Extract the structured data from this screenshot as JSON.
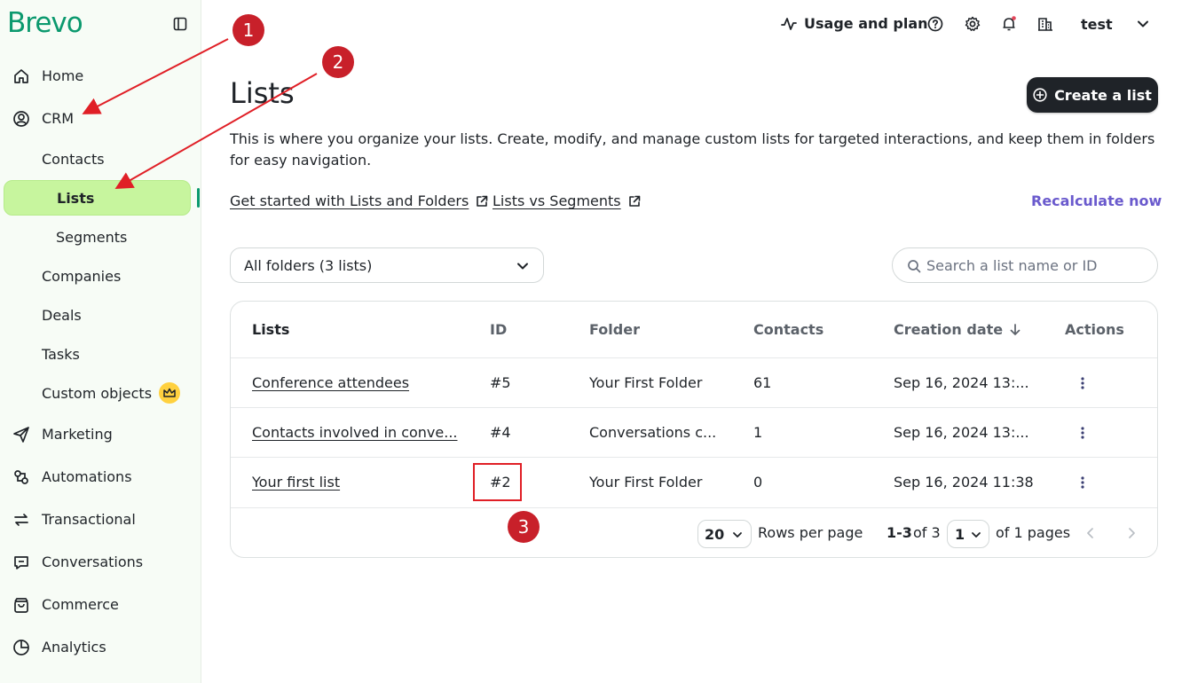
{
  "brand": {
    "name": "Brevo",
    "color": "#0b996e"
  },
  "header": {
    "usage_label": "Usage and plan",
    "user_name": "test"
  },
  "sidebar": {
    "items": [
      {
        "label": "Home",
        "icon": "home-icon"
      },
      {
        "label": "CRM",
        "icon": "user-circle-icon"
      },
      {
        "label": "Contacts"
      },
      {
        "label": "Lists",
        "active": true
      },
      {
        "label": "Segments"
      },
      {
        "label": "Companies"
      },
      {
        "label": "Deals"
      },
      {
        "label": "Tasks"
      },
      {
        "label": "Custom objects",
        "badge": "crown-icon"
      },
      {
        "label": "Marketing",
        "icon": "send-icon"
      },
      {
        "label": "Automations",
        "icon": "automation-icon"
      },
      {
        "label": "Transactional",
        "icon": "arrows-swap-icon"
      },
      {
        "label": "Conversations",
        "icon": "chat-icon"
      },
      {
        "label": "Commerce",
        "icon": "bag-icon"
      },
      {
        "label": "Analytics",
        "icon": "pie-chart-icon"
      }
    ]
  },
  "page": {
    "title": "Lists",
    "create_label": "Create a list",
    "description": "This is where you organize your lists. Create, modify, and manage custom lists for targeted interactions, and keep them in folders for easy navigation.",
    "link1": "Get started with Lists and Folders",
    "link2": "Lists vs Segments",
    "recalculate": "Recalculate now",
    "accent": "#6a5acd"
  },
  "filters": {
    "folder_value": "All folders (3 lists)",
    "search_placeholder": "Search a list name or ID"
  },
  "table": {
    "columns": [
      "Lists",
      "ID",
      "Folder",
      "Contacts",
      "Creation date",
      "Actions"
    ],
    "rows": [
      {
        "name": "Conference attendees",
        "id": "#5",
        "folder": "Your First Folder",
        "contacts": "61",
        "date": "Sep 16, 2024 13:..."
      },
      {
        "name": "Contacts involved in conve...",
        "id": "#4",
        "folder": "Conversations c...",
        "contacts": "1",
        "date": "Sep 16, 2024 13:..."
      },
      {
        "name": "Your first list",
        "id": "#2",
        "folder": "Your First Folder",
        "contacts": "0",
        "date": "Sep 16, 2024 11:38"
      }
    ]
  },
  "pagination": {
    "rows_per_page_value": "20",
    "rows_per_page_label": "Rows per page",
    "range_bold": "1-3",
    "range_rest": "of 3",
    "page_value": "1",
    "pages_label": "of 1 pages"
  },
  "annotations": {
    "step1": "1",
    "step2": "2",
    "step3": "3",
    "color": "#c8202a"
  }
}
